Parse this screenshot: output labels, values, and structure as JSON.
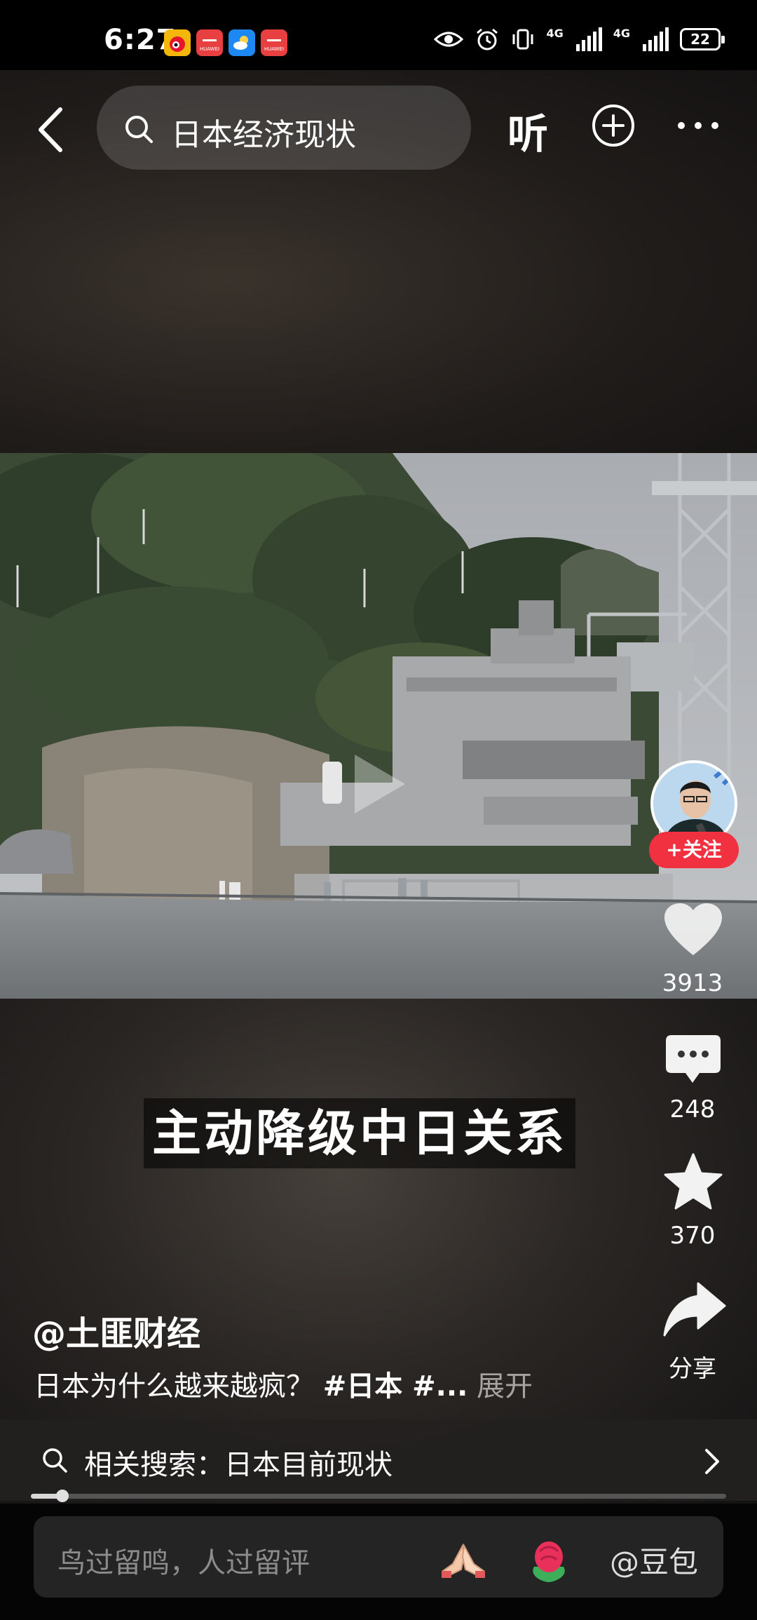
{
  "status_bar": {
    "time": "6:27",
    "network_1": "4G",
    "network_2": "4G",
    "battery": "22"
  },
  "header": {
    "search_query": "日本经济现状",
    "listen_label": "听"
  },
  "video": {
    "subtitle": "主动降级中日关系",
    "progress": 0.045
  },
  "rail": {
    "follow_label": "+关注",
    "like_count": "3913",
    "comment_count": "248",
    "favorite_count": "370",
    "share_label": "分享"
  },
  "post": {
    "author": "@土匪财经",
    "description": "日本为什么越来越疯？",
    "hashtags": "#日本 #...",
    "expand_label": "展开"
  },
  "related_search": {
    "text": "相关搜索：日本目前现状"
  },
  "comment_bar": {
    "placeholder": "鸟过留鸣，人过留评",
    "mention": "@豆包"
  },
  "colors": {
    "follow_red": "#f1313f",
    "accent_white": "#ffffff"
  }
}
